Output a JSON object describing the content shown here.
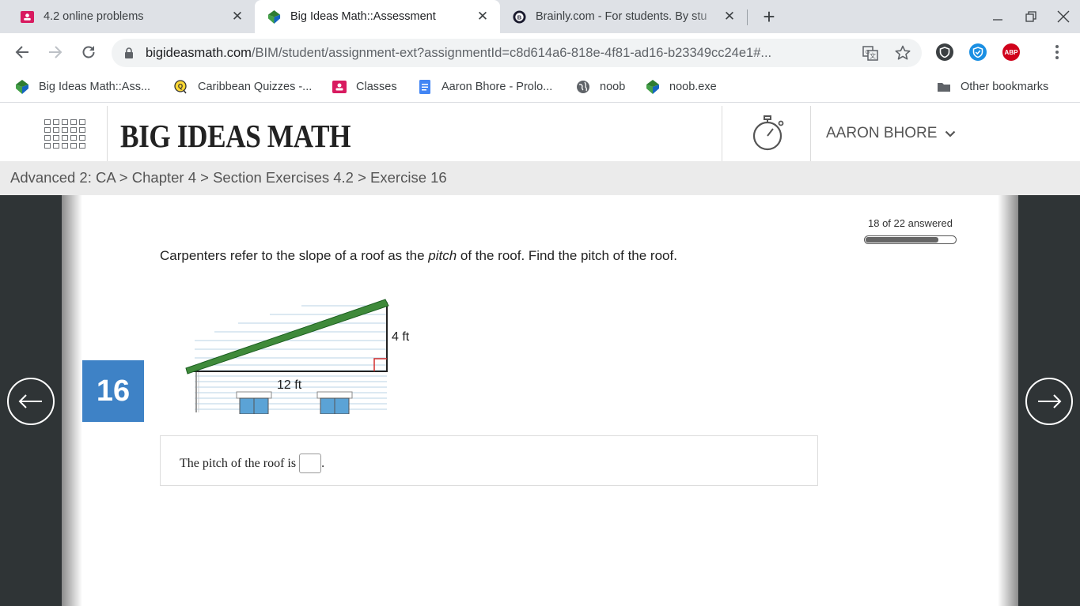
{
  "browser": {
    "tabs": [
      {
        "title": "4.2 online problems",
        "favicon": "classroom-icon",
        "active": false
      },
      {
        "title": "Big Ideas Math::Assessment",
        "favicon": "big-ideas-icon",
        "active": true
      },
      {
        "title": "Brainly.com - For students. By stu",
        "favicon": "brainly-icon",
        "active": false
      }
    ],
    "url_host": "bigideasmath.com",
    "url_path": "/BIM/student/assignment-ext?assignmentId=c8d614a6-818e-4f81-ad16-b23349cc24e1#...",
    "bookmarks": [
      {
        "label": "Big Ideas Math::Ass...",
        "icon": "big-ideas-icon"
      },
      {
        "label": "Caribbean Quizzes -...",
        "icon": "quizzes-icon"
      },
      {
        "label": "Classes",
        "icon": "classroom-icon"
      },
      {
        "label": "Aaron Bhore - Prolo...",
        "icon": "docs-icon"
      },
      {
        "label": "noob",
        "icon": "globe-icon"
      },
      {
        "label": "noob.exe",
        "icon": "big-ideas-icon"
      }
    ],
    "other_bookmarks": "Other bookmarks",
    "extensions": [
      "ublock-icon",
      "vpn-icon",
      "adblock-plus-icon"
    ],
    "extension_labels": {
      "abp": "ABP"
    }
  },
  "app": {
    "logo": "BIG IDEAS MATH",
    "user": "AARON BHORE",
    "breadcrumb": "Advanced 2: CA > Chapter 4 > Section Exercises 4.2 > Exercise 16"
  },
  "exercise": {
    "number": "16",
    "progress_text": "18 of 22 answered",
    "progress_fraction": 0.818,
    "question_pre": "Carpenters refer to the slope of a roof as the ",
    "question_em": "pitch",
    "question_post": " of the roof. Find the pitch of the roof.",
    "figure": {
      "rise_label": "4 ft",
      "run_label": "12 ft"
    },
    "answer_prefix": "The pitch of the roof is",
    "answer_suffix": ".",
    "answer_value": ""
  },
  "colors": {
    "accent_blue": "#3e82c6",
    "side_panel": "#2f3436",
    "roof_green": "#3f8a3a",
    "right_angle_red": "#d32f2f"
  }
}
